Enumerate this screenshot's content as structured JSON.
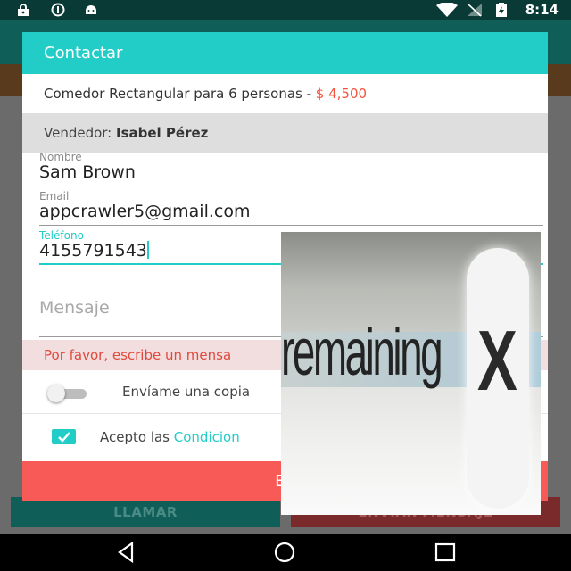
{
  "status_bar": {
    "time": "8:14",
    "icons": [
      "lock-icon",
      "circle-info-icon",
      "android-icon",
      "wifi-icon",
      "no-signal-icon",
      "battery-charging-icon"
    ]
  },
  "background_app": {
    "call_button": "LLAMAR",
    "send_button": "ENVIAR MENSAJE"
  },
  "dialog": {
    "title": "Contactar",
    "product": "Comedor Rectangular para 6 personas - ",
    "price": "$ 4,500",
    "seller_label": "Vendedor: ",
    "seller_name": "Isabel Pérez",
    "fields": {
      "name": {
        "label": "Nombre",
        "value": "Sam Brown"
      },
      "email": {
        "label": "Email",
        "value": "appcrawler5@gmail.com"
      },
      "phone": {
        "label": "Teléfono",
        "value": "4155791543"
      }
    },
    "message_placeholder": "Mensaje",
    "error": "Por favor, escribe un mensa",
    "copy_toggle": {
      "label": "Envíame una copia",
      "on": false
    },
    "terms": {
      "checked": true,
      "prefix": "Acepto las ",
      "link": "Condicion"
    },
    "send_button": "En"
  },
  "overlay_image": {
    "word": "remaining",
    "close_glyph": "X"
  },
  "navigation_bar": {
    "icons": [
      "back-icon",
      "home-icon",
      "recents-icon"
    ]
  }
}
